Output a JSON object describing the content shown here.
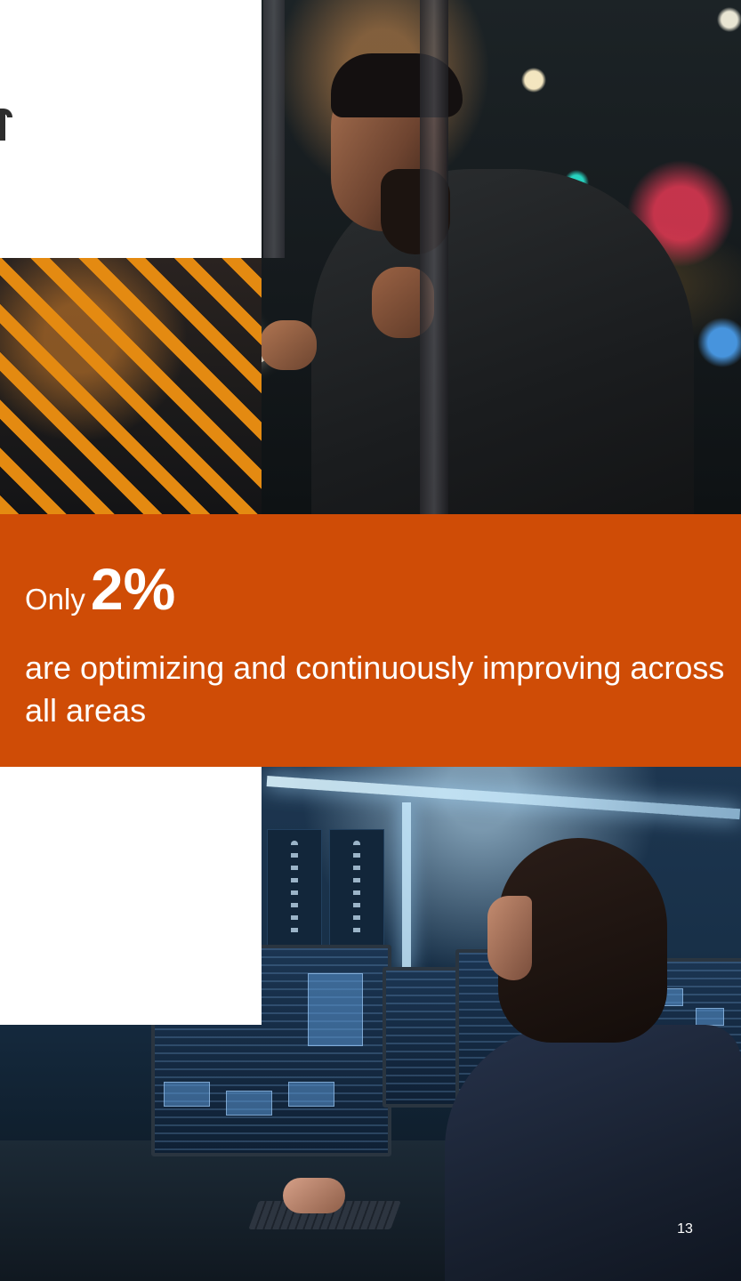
{
  "stat": {
    "prefix": "Only",
    "value": "2%",
    "description": "are optimizing and continuously improving across all areas"
  },
  "page_number": "13",
  "colors": {
    "band": "#cf4c06",
    "stripe": "#e48a11",
    "text": "#ffffff"
  }
}
